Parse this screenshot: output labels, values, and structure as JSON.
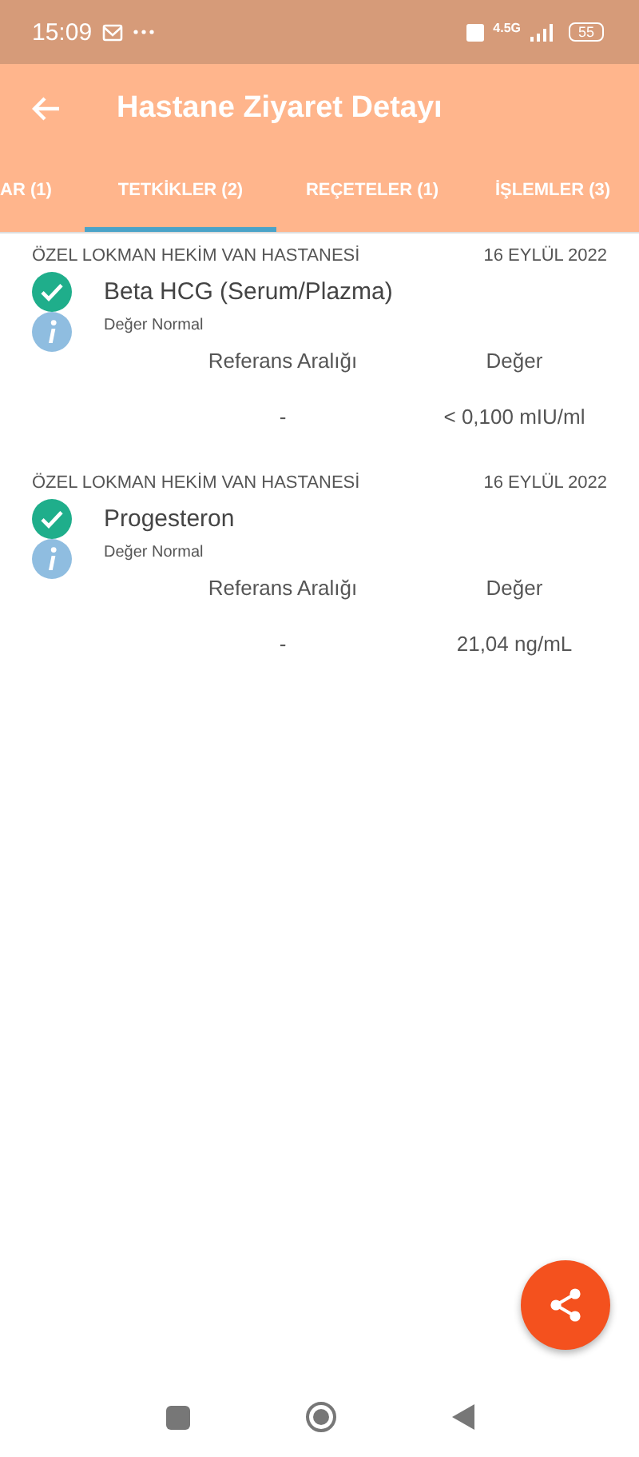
{
  "status_bar": {
    "time": "15:09",
    "network": "4.5G",
    "battery": "55"
  },
  "header": {
    "title": "Hastane Ziyaret Detayı"
  },
  "tabs": [
    {
      "label": "AR (1)",
      "selected": false
    },
    {
      "label": "TETKİKLER (2)",
      "selected": true
    },
    {
      "label": "REÇETELER (1)",
      "selected": false
    },
    {
      "label": "İŞLEMLER (3)",
      "selected": false
    }
  ],
  "results": [
    {
      "hospital": "ÖZEL LOKMAN HEKİM VAN HASTANESİ",
      "date": "16 EYLÜL 2022",
      "test": "Beta HCG (Serum/Plazma)",
      "status": "Değer Normal",
      "columns": [
        "Referans Aralığı",
        "Değer"
      ],
      "reference": "-",
      "value": "< 0,100 mIU/ml"
    },
    {
      "hospital": "ÖZEL LOKMAN HEKİM VAN HASTANESİ",
      "date": "16 EYLÜL 2022",
      "test": "Progesteron",
      "status": "Değer Normal",
      "columns": [
        "Referans Aralığı",
        "Değer"
      ],
      "reference": "-",
      "value": "21,04 ng/mL"
    }
  ]
}
